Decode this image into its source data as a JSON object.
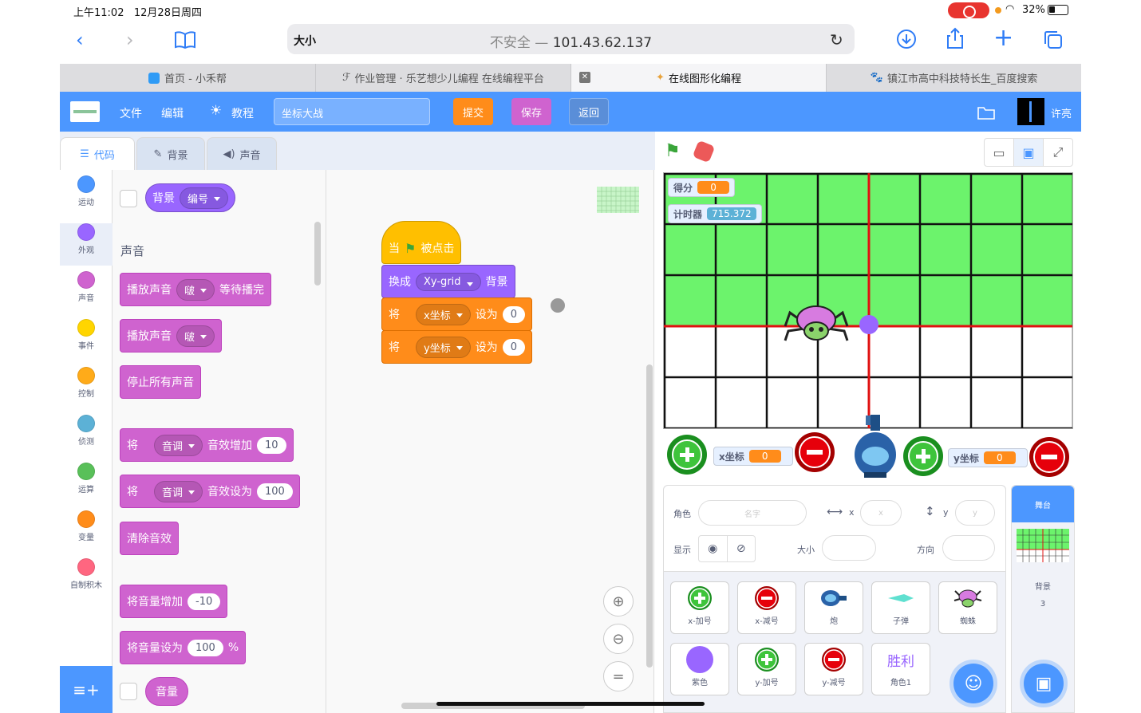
{
  "status": {
    "time": "上午11:02",
    "date": "12月28日周四",
    "battery": "32%"
  },
  "browser": {
    "text_size": "大小",
    "insecure": "不安全 — ",
    "address": "101.43.62.137"
  },
  "tabs": [
    {
      "label": "首页 - 小禾帮",
      "active": false
    },
    {
      "label": "作业管理 · 乐艺想少儿编程 在线编程平台",
      "active": false
    },
    {
      "label": "在线图形化编程",
      "active": true
    },
    {
      "label": "镇江市高中科技特长生_百度搜索",
      "active": false
    }
  ],
  "header": {
    "file": "文件",
    "edit": "编辑",
    "tutorial": "教程",
    "project_name": "坐标大战",
    "submit": "提交",
    "save": "保存",
    "back": "返回",
    "user": "许亮"
  },
  "editor_tabs": {
    "code": "代码",
    "backdrop": "背景",
    "sound": "声音"
  },
  "categories": [
    {
      "label": "运动",
      "color": "#4c97ff"
    },
    {
      "label": "外观",
      "color": "#9966ff"
    },
    {
      "label": "声音",
      "color": "#cf63cf"
    },
    {
      "label": "事件",
      "color": "#ffd500"
    },
    {
      "label": "控制",
      "color": "#ffab19"
    },
    {
      "label": "侦测",
      "color": "#5cb1d6"
    },
    {
      "label": "运算",
      "color": "#59c059"
    },
    {
      "label": "变量",
      "color": "#ff8c1a"
    },
    {
      "label": "自制积木",
      "color": "#ff6680"
    }
  ],
  "palette": {
    "backdrop_reporter": "背景",
    "backdrop_option": "编号",
    "section_title": "声音",
    "play_until_done": "播放声音",
    "sound_name": "啵",
    "until_done": "等待播完",
    "play_sound": "播放声音",
    "stop_all": "停止所有声音",
    "change_effect_prefix": "将",
    "effect": "音调",
    "change_effect": "音效增加",
    "change_val": "10",
    "set_effect": "音效设为",
    "set_val": "100",
    "clear_effects": "清除音效",
    "change_volume": "将音量增加",
    "change_volume_val": "-10",
    "set_volume": "将音量设为",
    "set_volume_val": "100",
    "percent": "%",
    "volume": "音量"
  },
  "script": {
    "hat_when": "当",
    "hat_clicked": "被点击",
    "switch": "换成",
    "backdrop_name": "Xy-grid",
    "backdrop_word": "背景",
    "set1_prefix": "将",
    "set1_var": "x坐标",
    "set1_to": "设为",
    "set1_val": "0",
    "set2_prefix": "将",
    "set2_var": "y坐标",
    "set2_to": "设为",
    "set2_val": "0"
  },
  "monitors": {
    "score_label": "得分",
    "score": "0",
    "timer_label": "计时器",
    "timer": "715.372",
    "x_label": "x坐标",
    "x": "0",
    "y_label": "y坐标",
    "y": "0"
  },
  "sprite_info": {
    "sprite": "角色",
    "name_placeholder": "名字",
    "x": "x",
    "x_ph": "x",
    "y": "y",
    "y_ph": "y",
    "show": "显示",
    "size": "大小",
    "direction": "方向"
  },
  "sprites": [
    {
      "name": "x-加号",
      "icon": "plus-icon"
    },
    {
      "name": "x-减号",
      "icon": "minus-icon"
    },
    {
      "name": "炮",
      "icon": "cannon-icon"
    },
    {
      "name": "子弹",
      "icon": "bullet-icon"
    },
    {
      "name": "蜘蛛",
      "icon": "spider-icon"
    },
    {
      "name": "紫色",
      "icon": "purple-dot-icon"
    },
    {
      "name": "y-加号",
      "icon": "plus-icon"
    },
    {
      "name": "y-减号",
      "icon": "minus-icon"
    },
    {
      "name": "角色1",
      "icon": "text-sprite",
      "text": "胜利"
    }
  ],
  "stage_pane": {
    "title": "舞台",
    "backdrop_label": "背景",
    "backdrop_count": "3"
  }
}
